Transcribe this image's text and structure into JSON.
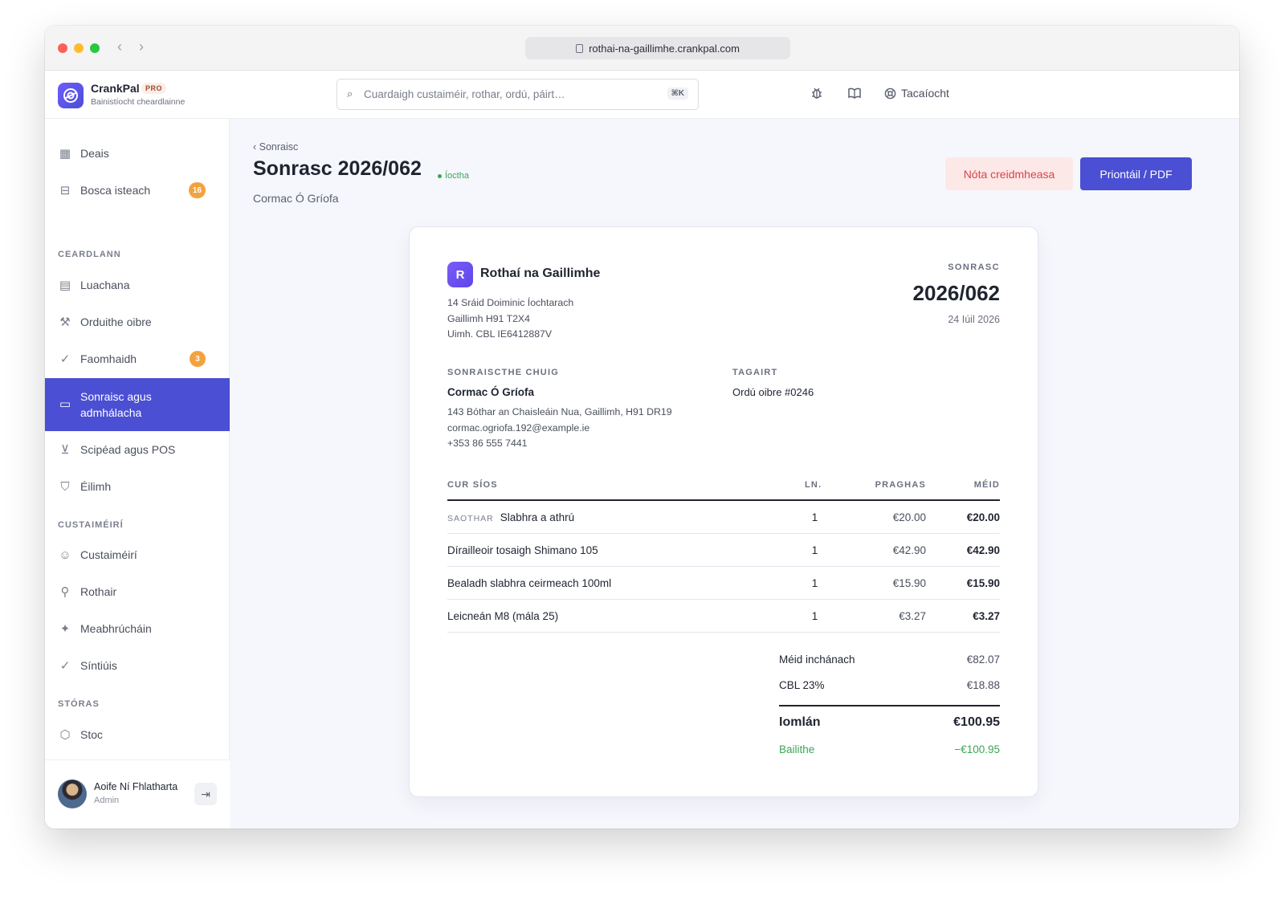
{
  "browser": {
    "url": "rothai-na-gaillimhe.crankpal.com"
  },
  "app": {
    "name": "CrankPal",
    "badge": "PRO",
    "subtitle": "Bainistíocht cheardlainne"
  },
  "search": {
    "placeholder": "Cuardaigh custaiméir, rothar, ordú, páirt…",
    "shortcut": "⌘K"
  },
  "topbar": {
    "support_label": "Tacaíocht"
  },
  "sidebar": {
    "items": [
      {
        "label": "Deais",
        "icon": "grid-icon"
      },
      {
        "label": "Bosca isteach",
        "icon": "inbox-icon",
        "badge": "16"
      },
      {
        "label": "Luachana",
        "icon": "document-icon"
      },
      {
        "label": "Orduithe oibre",
        "icon": "wrench-icon"
      },
      {
        "label": "Faomhaidh",
        "icon": "check-circle-icon",
        "badge": "3"
      },
      {
        "label": "Sonraisc agus admhálacha",
        "icon": "cash-icon"
      },
      {
        "label": "Scipéad agus POS",
        "icon": "cart-icon"
      },
      {
        "label": "Éilimh",
        "icon": "shield-icon"
      },
      {
        "label": "Custaiméirí",
        "icon": "users-icon"
      },
      {
        "label": "Rothair",
        "icon": "bike-icon"
      },
      {
        "label": "Meabhrúcháin",
        "icon": "sparkle-icon"
      },
      {
        "label": "Síntiúis",
        "icon": "check-circle-icon"
      },
      {
        "label": "Stoc",
        "icon": "box-icon"
      }
    ],
    "sections": [
      "CEARDLANN",
      "CUSTAIMÉIRÍ",
      "STÓRAS"
    ],
    "user": {
      "name": "Aoife Ní Fhlatharta",
      "role": "Admin"
    }
  },
  "page": {
    "breadcrumb": "‹ Sonraisc",
    "title": "Sonrasc 2026/062",
    "status": "Íoctha",
    "customer": "Cormac Ó Gríofa",
    "credit_note_label": "Nóta creidmheasa",
    "print_label": "Priontáil / PDF"
  },
  "invoice": {
    "logo_letter": "R",
    "shop_name": "Rothaí na Gaillimhe",
    "shop_address": [
      "14 Sráid Doiminic Íochtarach",
      "Gaillimh H91 T2X4",
      "Uimh. CBL IE6412887V"
    ],
    "doc_label": "SONRASC",
    "number": "2026/062",
    "date": "24 Iúil 2026",
    "billed_to_label": "SONRAISCTHE CHUIG",
    "billed_name": "Cormac Ó Gríofa",
    "billed_lines": [
      "143 Bóthar an Chaisleáin Nua, Gaillimh, H91 DR19",
      "cormac.ogriofa.192@example.ie",
      "+353 86 555 7441"
    ],
    "reference_label": "TAGAIRT",
    "reference": "Ordú oibre #0246",
    "columns": {
      "description": "CUR SÍOS",
      "qty": "LN.",
      "price": "PRAGHAS",
      "amount": "MÉID"
    },
    "lines": [
      {
        "tag": "SAOTHAR",
        "description": "Slabhra a athrú",
        "qty": "1",
        "price": "€20.00",
        "amount": "€20.00"
      },
      {
        "tag": "",
        "description": "Dírailleoir tosaigh Shimano 105",
        "qty": "1",
        "price": "€42.90",
        "amount": "€42.90"
      },
      {
        "tag": "",
        "description": "Bealadh slabhra ceirmeach 100ml",
        "qty": "1",
        "price": "€15.90",
        "amount": "€15.90"
      },
      {
        "tag": "",
        "description": "Leicneán M8 (mála 25)",
        "qty": "1",
        "price": "€3.27",
        "amount": "€3.27"
      }
    ],
    "subtotal_label": "Méid inchánach",
    "subtotal": "€82.07",
    "vat_label": "CBL 23%",
    "vat": "€18.88",
    "total_label": "Iomlán",
    "total": "€100.95",
    "paid_label": "Bailithe",
    "paid": "−€100.95"
  },
  "colors": {
    "accent": "#4a4fd3",
    "badge": "#f3a23f",
    "success": "#3aa655",
    "danger": "#d9434a"
  }
}
